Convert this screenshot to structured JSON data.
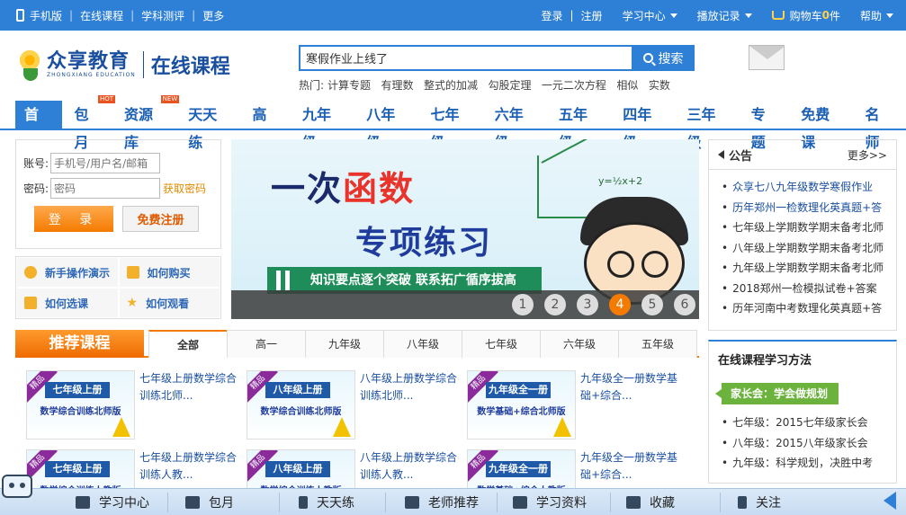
{
  "topbar": {
    "left_links": [
      "手机版",
      "在线课程",
      "学科测评",
      "更多"
    ],
    "right_links": {
      "login": "登录",
      "register": "注册",
      "study_center": "学习中心",
      "history": "播放记录",
      "cart_prefix": "购物车",
      "cart_count": "0",
      "cart_suffix": "件",
      "help": "帮助"
    }
  },
  "header": {
    "logo_cn": "众享教育",
    "logo_en": "ZHONGXIANG EDUCATION",
    "logo_right": "在线课程",
    "search_value": "寒假作业上线了",
    "search_button": "搜索",
    "hot_label": "热门:",
    "hot_terms": [
      "计算专题",
      "有理数",
      "整式的加减",
      "勾股定理",
      "一元二次方程",
      "相似",
      "实数"
    ]
  },
  "nav": {
    "items": [
      {
        "label": "首页",
        "badge": ""
      },
      {
        "label": "包月",
        "badge": "HOT"
      },
      {
        "label": "资源库",
        "badge": "NEW"
      },
      {
        "label": "天天练",
        "badge": ""
      },
      {
        "label": "高一",
        "badge": ""
      },
      {
        "label": "九年级",
        "badge": ""
      },
      {
        "label": "八年级",
        "badge": ""
      },
      {
        "label": "七年级",
        "badge": ""
      },
      {
        "label": "六年级",
        "badge": ""
      },
      {
        "label": "五年级",
        "badge": ""
      },
      {
        "label": "四年级",
        "badge": ""
      },
      {
        "label": "三年级",
        "badge": ""
      },
      {
        "label": "专题",
        "badge": ""
      },
      {
        "label": "免费课",
        "badge": ""
      },
      {
        "label": "名师",
        "badge": ""
      }
    ]
  },
  "login": {
    "account_label": "账号:",
    "account_placeholder": "手机号/用户名/邮箱",
    "password_label": "密码:",
    "password_placeholder": "密码",
    "forgot": "获取密码",
    "login_button": "登 录",
    "register_button": "免费注册"
  },
  "quick_links": [
    "新手操作演示",
    "如何购买",
    "如何选课",
    "如何观看"
  ],
  "banner": {
    "line1_a": "一次",
    "line1_b": "函数",
    "line2": "专项练习",
    "equation": "y=½x+2",
    "strip": "知识要点逐个突破 联系拓广循序拔高",
    "pages": [
      "1",
      "2",
      "3",
      "4",
      "5",
      "6"
    ],
    "active_page": 4
  },
  "notice": {
    "title": "公告",
    "more": "更多>>",
    "items": [
      "众享七八九年级数学寒假作业",
      "历年郑州一检数理化英真题+答",
      "七年级上学期数学期末备考北师",
      "八年级上学期数学期末备考北师",
      "九年级上学期数学期末备考北师",
      "2018郑州一检模拟试卷+答案",
      "历年河南中考数理化英真题+答"
    ]
  },
  "recommend": {
    "title": "推荐课程",
    "tabs": [
      "全部",
      "高一",
      "九年级",
      "八年级",
      "七年级",
      "六年级",
      "五年级"
    ],
    "courses": [
      {
        "tag": "精品",
        "grade": "七年级上册",
        "sub": "数学综合训练北师版",
        "text": "七年级上册数学综合训练北师..."
      },
      {
        "tag": "精品",
        "grade": "八年级上册",
        "sub": "数学综合训练北师版",
        "text": "八年级上册数学综合训练北师..."
      },
      {
        "tag": "精品",
        "grade": "九年级全一册",
        "sub": "数学基础+综合北师版",
        "text": "九年级全一册数学基础+综合..."
      },
      {
        "tag": "精品",
        "grade": "七年级上册",
        "sub": "数学综合训练人教版",
        "text": "七年级上册数学综合训练人教..."
      },
      {
        "tag": "精品",
        "grade": "八年级上册",
        "sub": "数学综合训练人教版",
        "text": "八年级上册数学综合训练人教..."
      },
      {
        "tag": "精品",
        "grade": "九年级全一册",
        "sub": "数学基础+综合人教版",
        "text": "九年级全一册数学基础+综合..."
      }
    ]
  },
  "method": {
    "title": "在线课程学习方法",
    "pill": "家长会：学会做规划",
    "items": [
      "七年级：2015七年级家长会",
      "八年级：2015八年级家长会",
      "九年级：科学规划，决胜中考"
    ]
  },
  "bottombar": [
    "学习中心",
    "包月",
    "天天练",
    "老师推荐",
    "学习资料",
    "收藏",
    "关注"
  ]
}
